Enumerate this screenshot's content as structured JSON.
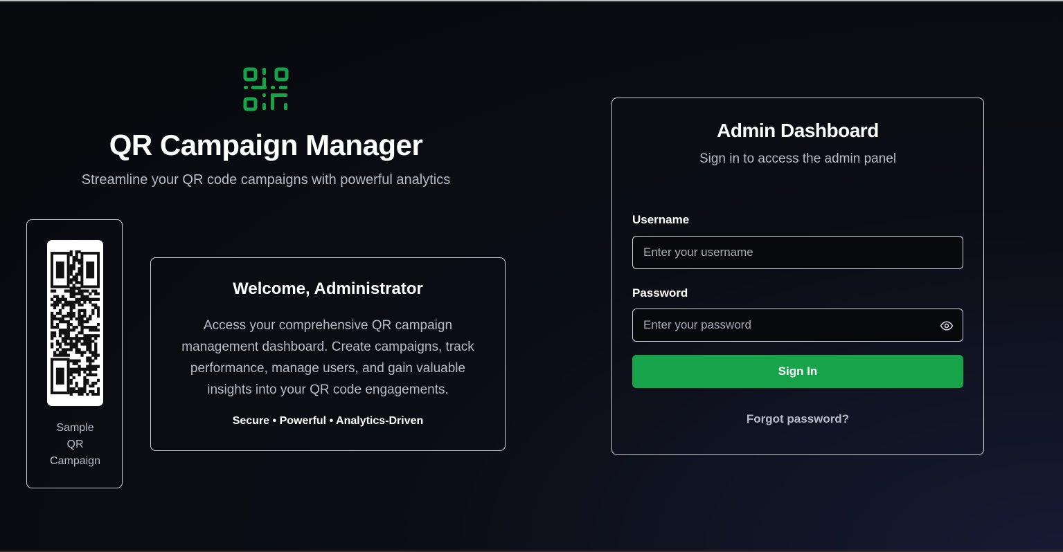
{
  "brand": {
    "title": "QR Campaign Manager",
    "subtitle": "Streamline your QR code campaigns with powerful analytics",
    "logo_icon": "qr-code-icon",
    "accent_color": "#16a34a"
  },
  "sample_qr": {
    "caption_line1": "Sample",
    "caption_line2": "QR",
    "caption_line3": "Campaign"
  },
  "welcome": {
    "title": "Welcome, Administrator",
    "text": "Access your comprehensive QR campaign management dashboard. Create campaigns, track performance, manage users, and gain valuable insights into your QR code engagements.",
    "tagline": "Secure • Powerful • Analytics-Driven"
  },
  "login": {
    "title": "Admin Dashboard",
    "subtitle": "Sign in to access the admin panel",
    "username_label": "Username",
    "username_placeholder": "Enter your username",
    "username_value": "",
    "password_label": "Password",
    "password_placeholder": "Enter your password",
    "password_value": "",
    "show_password_icon": "eye-icon",
    "signin_label": "Sign In",
    "forgot_label": "Forgot password?",
    "button_color": "#17a34a"
  }
}
